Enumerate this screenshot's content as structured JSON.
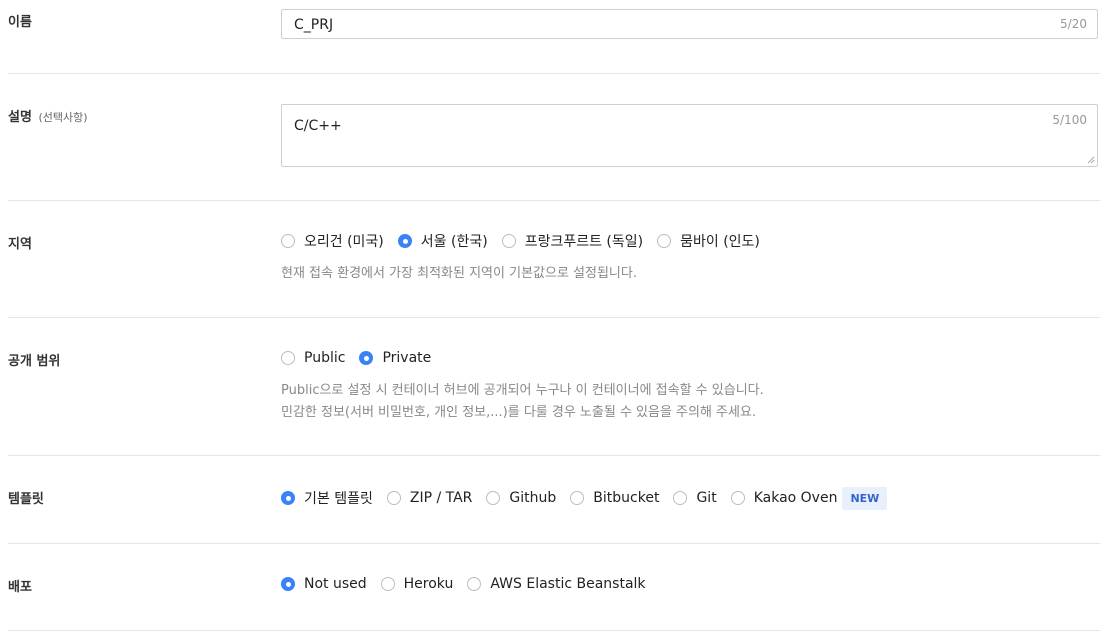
{
  "name": {
    "label": "이름",
    "value": "C_PRJ",
    "counter": "5/20"
  },
  "description": {
    "label": "설명",
    "optional": "(선택사항)",
    "value": "C/C++",
    "counter": "5/100"
  },
  "region": {
    "label": "지역",
    "options": [
      "오리건 (미국)",
      "서울 (한국)",
      "프랑크푸르트 (독일)",
      "뭄바이 (인도)"
    ],
    "selected": "서울 (한국)",
    "help": "현재 접속 환경에서 가장 최적화된 지역이 기본값으로 설정됩니다."
  },
  "visibility": {
    "label": "공개 범위",
    "options": [
      "Public",
      "Private"
    ],
    "selected": "Private",
    "help_line1": "Public으로 설정 시 컨테이너 허브에 공개되어 누구나 이 컨테이너에 접속할 수 있습니다.",
    "help_line2": "민감한 정보(서버 비밀번호, 개인 정보,...)를 다룰 경우 노출될 수 있음을 주의해 주세요."
  },
  "template": {
    "label": "템플릿",
    "options": [
      "기본 템플릿",
      "ZIP / TAR",
      "Github",
      "Bitbucket",
      "Git",
      "Kakao Oven"
    ],
    "selected": "기본 템플릿",
    "badge": "NEW"
  },
  "deploy": {
    "label": "배포",
    "options": [
      "Not used",
      "Heroku",
      "AWS Elastic Beanstalk"
    ],
    "selected": "Not used"
  },
  "colors": {
    "accent": "#3b82f6",
    "badge_bg": "#e8f0fe",
    "badge_text": "#3563c9"
  }
}
